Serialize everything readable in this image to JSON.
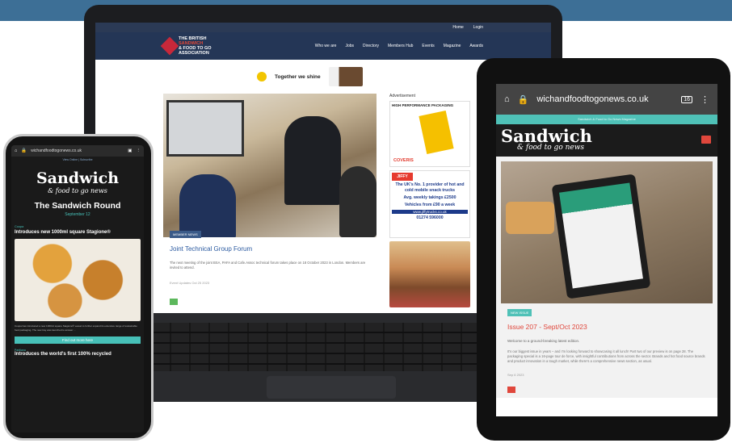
{
  "laptop": {
    "topbar": {
      "home": "Home",
      "login": "Login"
    },
    "logo": {
      "line1": "THE BRITISH",
      "line2": "SANDWICH",
      "line3": "& FOOD TO GO",
      "line4": "ASSOCIATION"
    },
    "nav": [
      "Who we are",
      "Jobs",
      "Directory",
      "Members Hub",
      "Events",
      "Magazine",
      "Awards"
    ],
    "sponsor_tagline": "Together we shine",
    "article": {
      "badge": "MEMBER NEWS",
      "title": "Joint Technical Group Forum",
      "text": "The next meeting of the joint BSA, PAFA and Cafe.Assoc technical forum takes place on 18 October 2023 in London. Members are invited to attend.",
      "meta": "Event Updates   Oct 25 2023"
    },
    "ads": {
      "label": "Advertisement",
      "ad1_heading": "HIGH PERFORMANCE PACKAGING",
      "ad1_brand": "COVERIS",
      "ad2_logo": "JIFFY",
      "ad2_line1": "The UK's No. 1 provider of hot and cold mobile snack trucks",
      "ad2_line2": "Avg. weekly takings £2500",
      "ad2_line3": "Vehicles from £90 a week",
      "ad2_site": "www.jiffytrucks.co.uk",
      "ad2_phone": "01274 596000"
    }
  },
  "phone": {
    "url": "wichandfoodtogonews.co.uk",
    "top_link": "View Online   |   Subscribe",
    "brand_main": "Sandwich",
    "brand_sub": "& food to go news",
    "newsletter_title": "The Sandwich Round",
    "newsletter_date": "September 12",
    "section": "Coupa",
    "headline": "Introduces new 1000ml square Stagione®",
    "body": "Coupa has introduced a new 1000ml square Stagione® vessel to further expand its extensive range of sustainable food packaging. The new tray was launched to answer ...",
    "cta": "Find out more here",
    "next_section": "Partilana",
    "next_headline": "Introduces the world's first 100% recycled"
  },
  "tablet": {
    "url": "wichandfoodtogonews.co.uk",
    "tab_count": "16",
    "strip": "Sandwich & Food to Go News Magazine",
    "brand_main": "Sandwich",
    "brand_sub": "& food to go news",
    "badge": "NEW ISSUE",
    "title": "Issue 207 - Sept/Oct 2023",
    "subtitle": "Welcome to a ground-breaking latest edition.",
    "body": "It's our biggest issue in years – and I'm looking forward to showcasing it all lunch! Part two of our preview is on page 28. The packaging special is a 16-page tour de force, with insightful contributions from across the sector. Brands and hot food source brands and product innovation in a tough market, while there's a comprehensive news section, as usual.",
    "meta": "Sep 6 2023"
  },
  "colors": {
    "band": "#3d6f96",
    "teal": "#4fc1b7",
    "red": "#e0473c",
    "navy": "#243656"
  }
}
